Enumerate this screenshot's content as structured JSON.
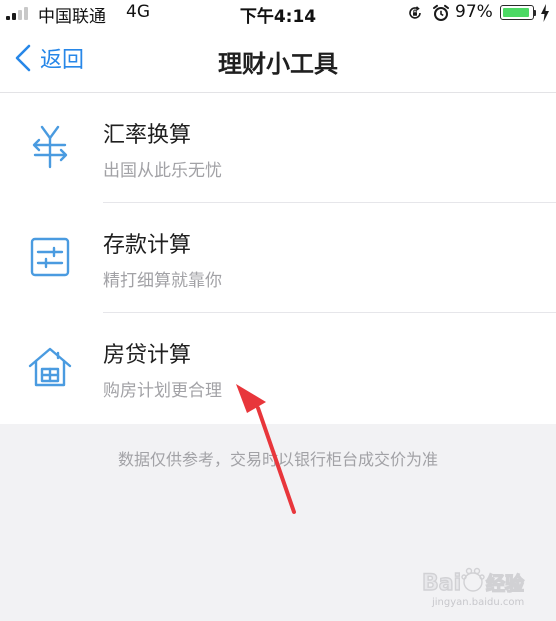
{
  "status_bar": {
    "carrier": "中国联通",
    "network": "4G",
    "time": "下午4:14",
    "battery_percent": "97%",
    "battery_level": 0.97,
    "battery_color": "#4cd964"
  },
  "nav": {
    "back_label": "返回",
    "title": "理财小工具",
    "accent_color": "#2787e8"
  },
  "tools": [
    {
      "title": "汇率换算",
      "subtitle": "出国从此乐无忧",
      "icon": "yen-exchange-icon"
    },
    {
      "title": "存款计算",
      "subtitle": "精打细算就靠你",
      "icon": "deposit-sliders-icon"
    },
    {
      "title": "房贷计算",
      "subtitle": "购房计划更合理",
      "icon": "house-icon"
    }
  ],
  "footer_note": "数据仅供参考，交易时以银行柜台成交价为准",
  "annotation": {
    "color": "#e8363b",
    "points_to": "房贷计算"
  },
  "watermark": {
    "brand": "Bai百度经验",
    "url": "jingyan.baidu.com"
  }
}
